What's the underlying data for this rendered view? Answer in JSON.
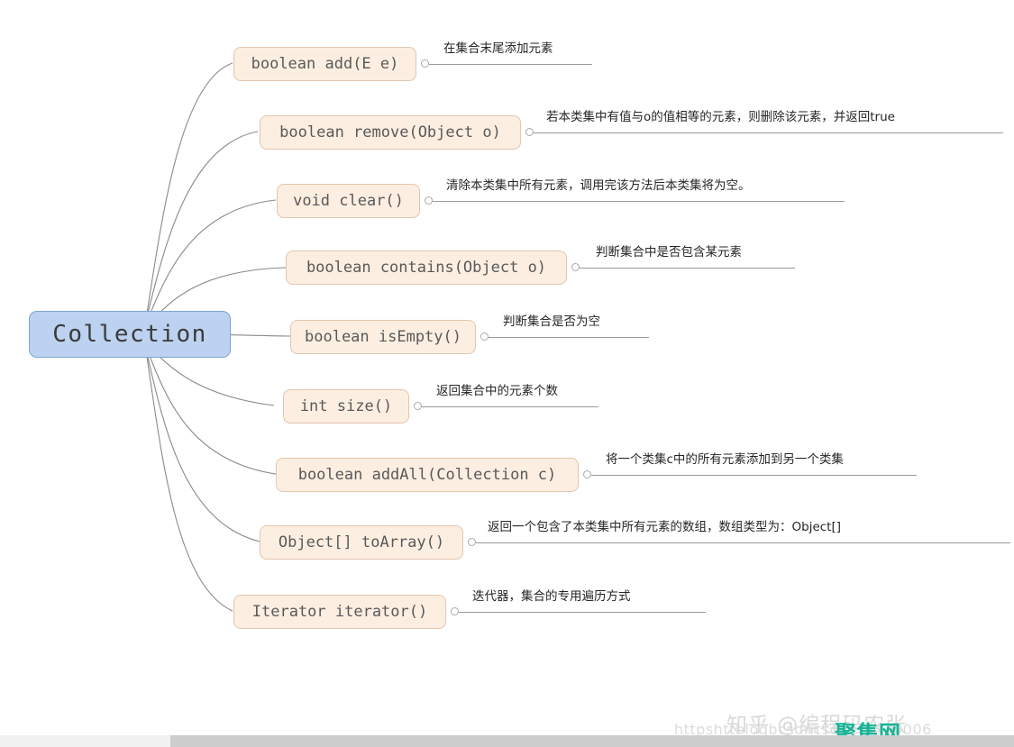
{
  "diagram": {
    "type": "mindmap",
    "root": {
      "label": "Collection",
      "color": "#bcd2f0",
      "border_color": "#7fa3d4"
    },
    "node_color": "#fceee1",
    "node_border_color": "#e3c6ae",
    "branches": [
      {
        "signature": "boolean add(E e)",
        "note": "在集合末尾添加元素"
      },
      {
        "signature": "boolean remove(Object o)",
        "note": "若本类集中有值与o的值相等的元素，则删除该元素，并返回true"
      },
      {
        "signature": "void clear()",
        "note": "清除本类集中所有元素，调用完该方法后本类集将为空。"
      },
      {
        "signature": "boolean contains(Object o)",
        "note": "判断集合中是否包含某元素"
      },
      {
        "signature": "boolean isEmpty()",
        "note": "判断集合是否为空"
      },
      {
        "signature": "int size()",
        "note": "返回集合中的元素个数"
      },
      {
        "signature": "boolean addAll(Collection c)",
        "note": "将一个类集c中的所有元素添加到另一个类集"
      },
      {
        "signature": "Object[] toArray()",
        "note": "返回一个包含了本类集中所有元素的数组，数组类型为：Object[]"
      },
      {
        "signature": "Iterator iterator()",
        "note": "迭代器，集合的专用遍历方式"
      }
    ]
  },
  "watermark": {
    "zhihu": "知乎 @编程码农张",
    "url": "httpshttblogbcsdncsdnet4449006",
    "logo": "聚集网",
    "logo_color": "#16b394"
  }
}
